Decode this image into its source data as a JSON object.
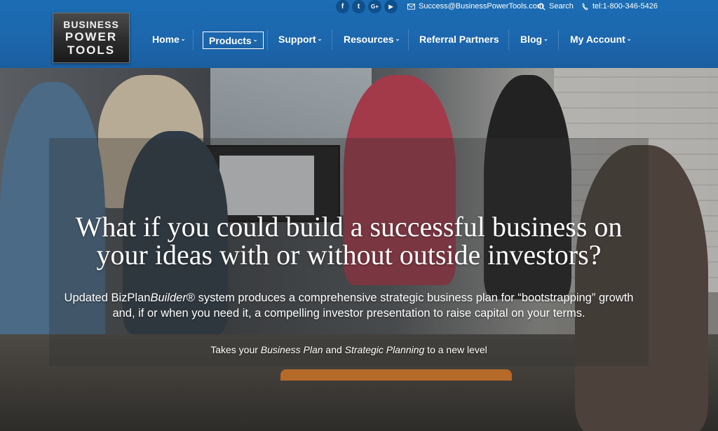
{
  "logo": {
    "line1": "BUSINESS",
    "line2": "POWER",
    "line3": "TOOLS"
  },
  "utility": {
    "social": [
      {
        "icon": "facebook-icon",
        "glyph": "f"
      },
      {
        "icon": "twitter-icon",
        "glyph": "t"
      },
      {
        "icon": "google-plus-icon",
        "glyph": "G+"
      },
      {
        "icon": "youtube-icon",
        "glyph": "▶"
      }
    ],
    "email": "Success@BusinessPowerTools.com",
    "search": "Search",
    "phone": "tel:1-800-346-5426"
  },
  "nav": {
    "items": [
      {
        "label": "Home",
        "chev": "⌄"
      },
      {
        "label": "Products",
        "chev": "⌄"
      },
      {
        "label": "Support",
        "chev": "⌄"
      },
      {
        "label": "Resources",
        "chev": "⌄"
      },
      {
        "label": "Referral Partners",
        "chev": ""
      },
      {
        "label": "Blog",
        "chev": "⌄"
      },
      {
        "label": "My Account",
        "chev": "⌄"
      }
    ]
  },
  "hero": {
    "headline": "What if you could build a successful business on your ideas with or without outside investors?",
    "sub_part1": "Updated BizPlan",
    "sub_italic": "Builder",
    "sub_part2": "® system produces a comprehensive strategic business plan for “bootstrapping” growth and, if or when you need it, a compelling investor presentation to raise capital on your terms.",
    "tag_part1": "Takes your ",
    "tag_italic1": "Business Plan",
    "tag_part2": " and ",
    "tag_italic2": "Strategic Planning",
    "tag_part3": " to a new level"
  },
  "colors": {
    "header": "#1b6db4",
    "social_bg": "#0f4f8c"
  }
}
